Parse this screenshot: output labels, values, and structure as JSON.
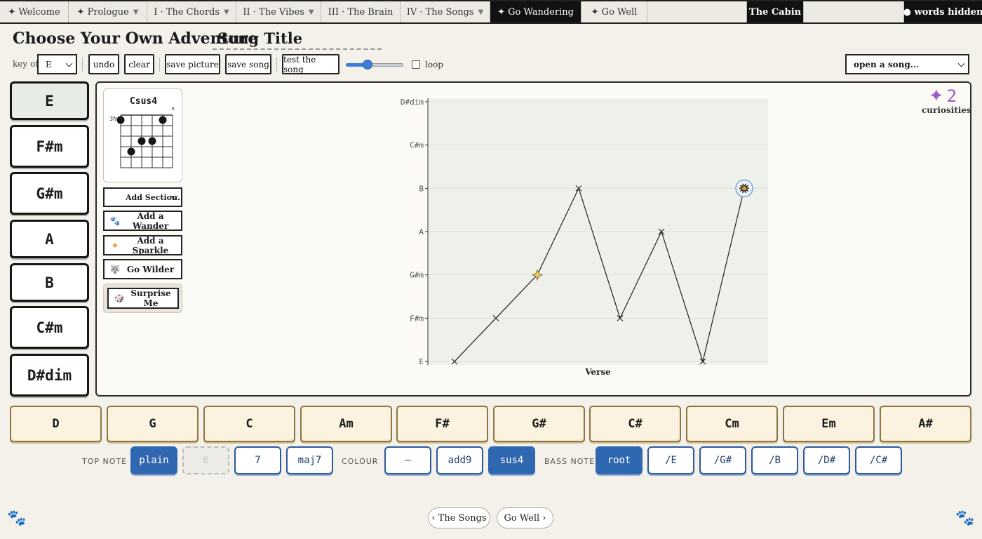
{
  "nav": {
    "tabs": [
      {
        "label": "✦ Welcome",
        "caret": ""
      },
      {
        "label": "✦ Prologue",
        "caret": "▼"
      },
      {
        "label": "I · The Chords",
        "caret": "▼"
      },
      {
        "label": "II · The Vibes",
        "caret": "▼"
      },
      {
        "label": "III · The Brain",
        "caret": ""
      },
      {
        "label": "IV · The Songs",
        "caret": "▼"
      },
      {
        "label": "✦ Go Wandering",
        "caret": ""
      },
      {
        "label": "✦ Go Well",
        "caret": ""
      }
    ],
    "cabin": "The Cabin",
    "words_hidden": "● words hidden"
  },
  "title": "Choose Your Own Adventure",
  "song_title": "Song Title",
  "toolbar": {
    "key_label": "key of",
    "key_value": "E",
    "undo": "undo",
    "clear": "clear",
    "save_picture": "save picture",
    "save_song": "save song",
    "test_song": "test the song",
    "tempo_fraction": 0.38,
    "loop_label": "loop",
    "open_song": "open a song..."
  },
  "key_chords": [
    "E",
    "F#m",
    "G#m",
    "A",
    "B",
    "C#m",
    "D#dim"
  ],
  "diagram": {
    "chord_name": "Csus4",
    "fret_label": "3fr",
    "muted_marker": "×"
  },
  "side_buttons": {
    "add_section": "Add Section.",
    "add_wander": "Add a Wander",
    "add_sparkle": "Add a Sparkle",
    "go_wilder": "Go Wilder",
    "surprise_me": "Surprise Me"
  },
  "curiosities": {
    "count": "2",
    "label": "curiosities"
  },
  "chart_data": {
    "type": "line",
    "xlabel": "Verse",
    "y_categories": [
      "E",
      "F#m",
      "G#m",
      "A",
      "B",
      "C#m",
      "D#dim"
    ],
    "points": [
      "E",
      "F#m",
      "G#m",
      "B",
      "F#m",
      "A",
      "E",
      "B"
    ],
    "sparkle_index": 2,
    "burst_index": 7,
    "grid": true
  },
  "extra_chords": [
    "D",
    "G",
    "C",
    "Am",
    "F#",
    "G#",
    "C#",
    "Cm",
    "Em",
    "A#"
  ],
  "modifiers": {
    "top_note_label": "TOP NOTE",
    "top_note": [
      {
        "label": "plain",
        "state": "on"
      },
      {
        "label": "6",
        "state": "dim"
      },
      {
        "label": "7",
        "state": "off"
      },
      {
        "label": "maj7",
        "state": "off"
      }
    ],
    "colour_label": "COLOUR",
    "colour": [
      {
        "label": "—",
        "state": "off"
      },
      {
        "label": "add9",
        "state": "off"
      },
      {
        "label": "sus4",
        "state": "on"
      }
    ],
    "bass_note_label": "BASS NOTE",
    "bass_note": [
      {
        "label": "root",
        "state": "on"
      },
      {
        "label": "/E",
        "state": "off"
      },
      {
        "label": "/G#",
        "state": "off"
      },
      {
        "label": "/B",
        "state": "off"
      },
      {
        "label": "/D#",
        "state": "off"
      },
      {
        "label": "/C#",
        "state": "off"
      }
    ]
  },
  "footer": {
    "prev": "‹ The Songs",
    "next": "Go Well ›"
  },
  "colors": {
    "accent_blue": "#2f67b0",
    "curiosity_purple": "#9b5dc6",
    "sparkle_gold": "#e0a53a",
    "chart_bg": "#eef0ea"
  },
  "icons": {
    "paw": "paw-icon",
    "sparkle": "sparkle-icon",
    "wolf": "wolf-icon",
    "dice": "dice-icon"
  }
}
